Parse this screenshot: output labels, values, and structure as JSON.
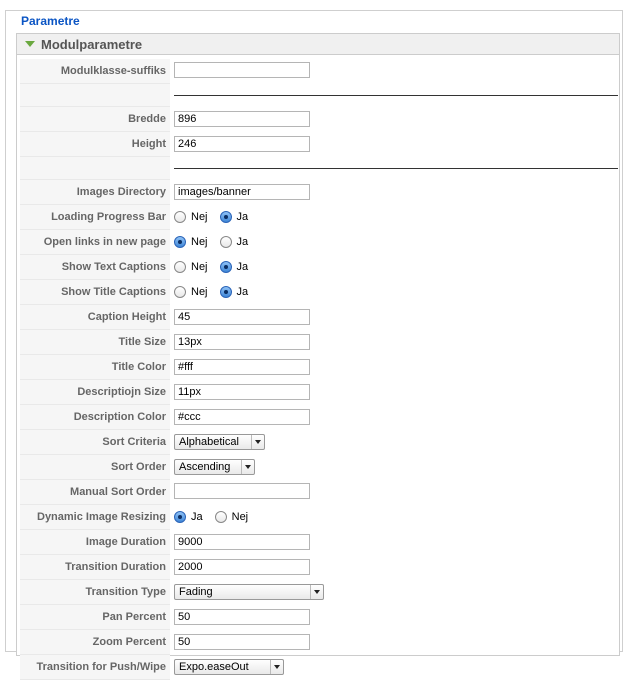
{
  "fieldset": {
    "legend": "Parametre"
  },
  "panel": {
    "title": "Modulparametre"
  },
  "fields": {
    "modulklasse_suffiks": {
      "label": "Modulklasse-suffiks",
      "value": ""
    },
    "bredde": {
      "label": "Bredde",
      "value": "896"
    },
    "height": {
      "label": "Height",
      "value": "246"
    },
    "images_directory": {
      "label": "Images Directory",
      "value": "images/banner"
    },
    "loading_progress_bar": {
      "label": "Loading Progress Bar",
      "options": [
        "Nej",
        "Ja"
      ],
      "selected": "Ja"
    },
    "open_links_new_page": {
      "label": "Open links in new page",
      "options": [
        "Nej",
        "Ja"
      ],
      "selected": "Nej"
    },
    "show_text_captions": {
      "label": "Show Text Captions",
      "options": [
        "Nej",
        "Ja"
      ],
      "selected": "Ja"
    },
    "show_title_captions": {
      "label": "Show Title Captions",
      "options": [
        "Nej",
        "Ja"
      ],
      "selected": "Ja"
    },
    "caption_height": {
      "label": "Caption Height",
      "value": "45"
    },
    "title_size": {
      "label": "Title Size",
      "value": "13px"
    },
    "title_color": {
      "label": "Title Color",
      "value": "#fff"
    },
    "description_size": {
      "label": "Descriptiojn Size",
      "value": "11px"
    },
    "description_color": {
      "label": "Description Color",
      "value": "#ccc"
    },
    "sort_criteria": {
      "label": "Sort Criteria",
      "value": "Alphabetical"
    },
    "sort_order": {
      "label": "Sort Order",
      "value": "Ascending"
    },
    "manual_sort_order": {
      "label": "Manual Sort Order",
      "value": ""
    },
    "dynamic_image_resizing": {
      "label": "Dynamic Image Resizing",
      "options": [
        "Ja",
        "Nej"
      ],
      "selected": "Ja"
    },
    "image_duration": {
      "label": "Image Duration",
      "value": "9000"
    },
    "transition_duration": {
      "label": "Transition Duration",
      "value": "2000"
    },
    "transition_type": {
      "label": "Transition Type",
      "value": "Fading"
    },
    "pan_percent": {
      "label": "Pan Percent",
      "value": "50"
    },
    "zoom_percent": {
      "label": "Zoom Percent",
      "value": "50"
    },
    "transition_push_wipe": {
      "label": "Transition for Push/Wipe",
      "value": "Expo.easeOut"
    }
  },
  "colors": {
    "legend": "#0b55c4",
    "triangle": "#6aa83f",
    "radio_checked": "#3f86d6"
  }
}
